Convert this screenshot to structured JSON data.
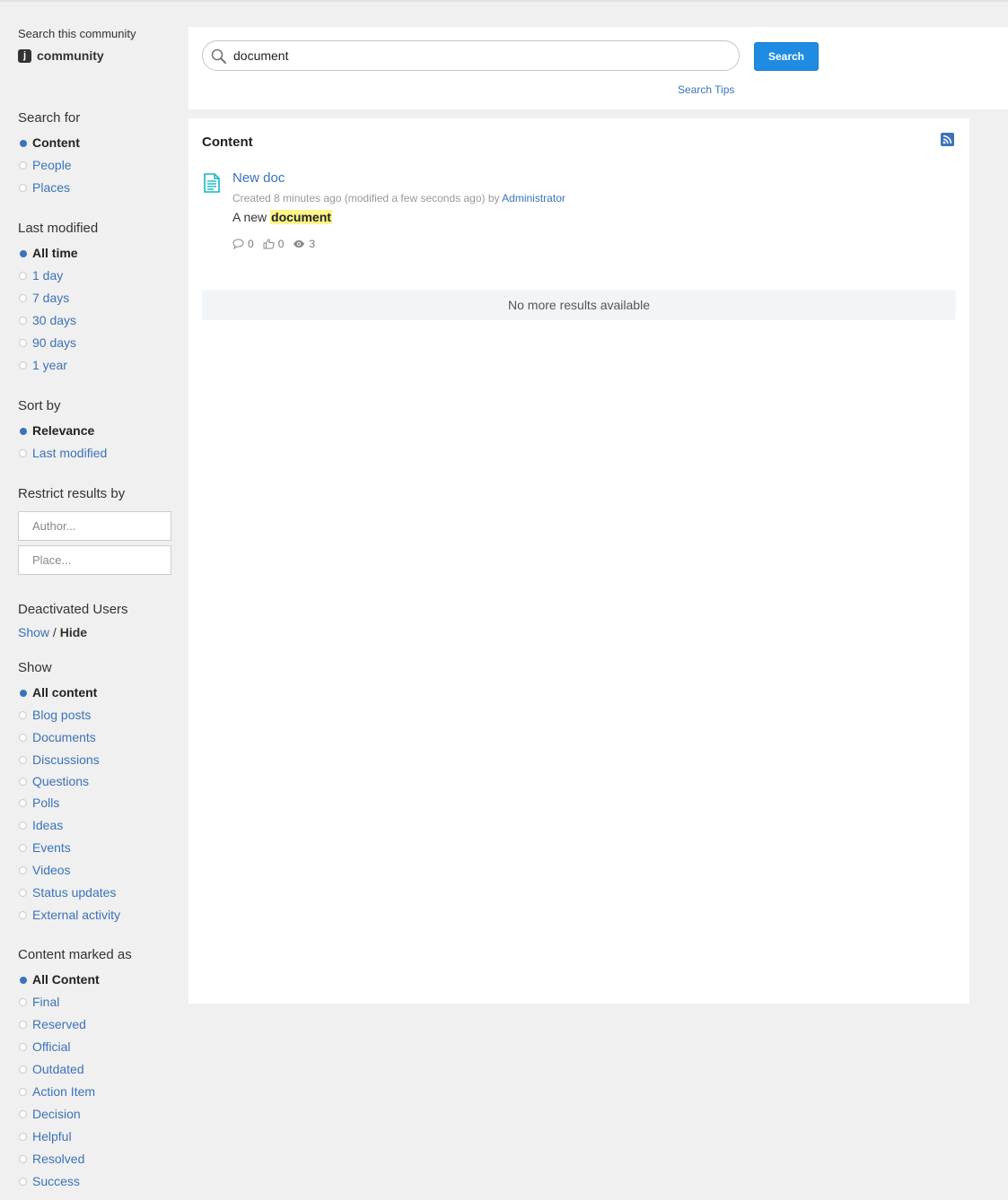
{
  "search_context": {
    "label": "Search this community",
    "logo_letter": "j",
    "community_name": "community"
  },
  "search": {
    "query": "document",
    "button_label": "Search",
    "tips_label": "Search Tips"
  },
  "filters": {
    "search_for": {
      "title": "Search for",
      "options": [
        "Content",
        "People",
        "Places"
      ]
    },
    "last_modified": {
      "title": "Last modified",
      "options": [
        "All time",
        "1 day",
        "7 days",
        "30 days",
        "90 days",
        "1 year"
      ]
    },
    "sort_by": {
      "title": "Sort by",
      "options": [
        "Relevance",
        "Last modified"
      ]
    },
    "restrict": {
      "title": "Restrict results by",
      "author_placeholder": "Author...",
      "place_placeholder": "Place..."
    },
    "deactivated": {
      "title": "Deactivated Users",
      "show_label": "Show",
      "separator": "/",
      "hide_label": "Hide"
    },
    "show": {
      "title": "Show",
      "options": [
        "All content",
        "Blog posts",
        "Documents",
        "Discussions",
        "Questions",
        "Polls",
        "Ideas",
        "Events",
        "Videos",
        "Status updates",
        "External activity"
      ]
    },
    "marked_as": {
      "title": "Content marked as",
      "options": [
        "All Content",
        "Final",
        "Reserved",
        "Official",
        "Outdated",
        "Action Item",
        "Decision",
        "Helpful",
        "Resolved",
        "Success"
      ]
    }
  },
  "results": {
    "title": "Content",
    "items": [
      {
        "title": "New doc",
        "meta_prefix": "Created 8 minutes ago (modified a few seconds ago) by",
        "author": "Administrator",
        "snippet_before": "A new ",
        "snippet_highlight": "document",
        "comments": "0",
        "likes": "0",
        "views": "3"
      }
    ],
    "no_more_label": "No more results available"
  },
  "colors": {
    "accent": "#3b73b9",
    "button": "#1f8ce3",
    "highlight": "#fff58a",
    "doc_icon": "#13b5c6"
  }
}
